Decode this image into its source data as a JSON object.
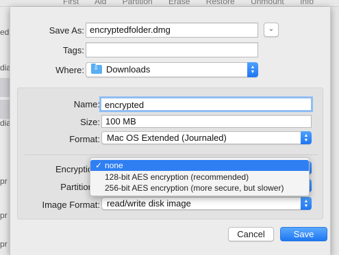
{
  "background": {
    "toolbar_items": "First Aid  Partition  Erase  Restore  Unmount  Info",
    "left_fragments": [
      "edi",
      "dia",
      "dia",
      "pr",
      "pr",
      "pr"
    ]
  },
  "dialog": {
    "save_as_label": "Save As:",
    "save_as_value": "encryptedfolder.dmg",
    "tags_label": "Tags:",
    "tags_value": "",
    "where_label": "Where:",
    "where_value": "Downloads",
    "name_label": "Name:",
    "name_value": "encrypted",
    "size_label": "Size:",
    "size_value": "100 MB",
    "format_label": "Format:",
    "format_value": "Mac OS Extended (Journaled)",
    "encryption_label": "Encryption:",
    "partitions_label": "Partitions:",
    "image_format_label": "Image Format:",
    "image_format_value": "read/write disk image",
    "cancel_label": "Cancel",
    "save_label": "Save"
  },
  "encryption_menu": {
    "check": "✓",
    "items": [
      {
        "label": "none",
        "selected": true
      },
      {
        "label": "128-bit AES encryption (recommended)",
        "selected": false
      },
      {
        "label": "256-bit AES encryption (more secure, but slower)",
        "selected": false
      }
    ]
  },
  "colors": {
    "accent": "#2f7ff3",
    "folder": "#5aaef3"
  }
}
